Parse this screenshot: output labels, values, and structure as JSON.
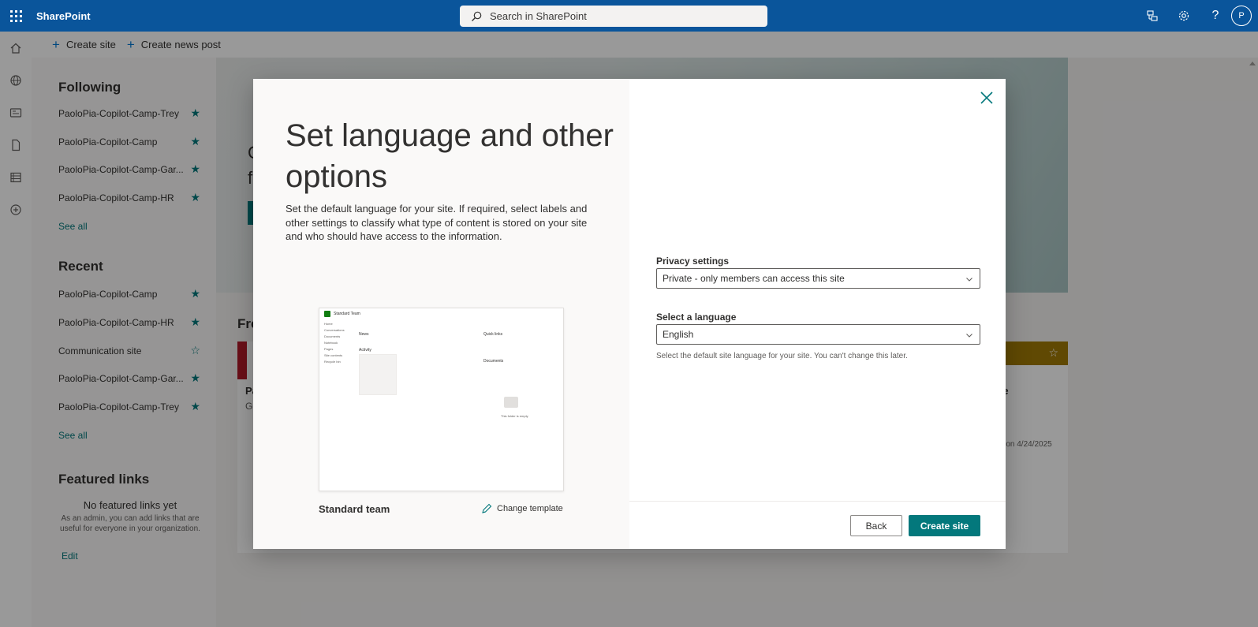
{
  "topbar": {
    "brand": "SharePoint",
    "search_placeholder": "Search in SharePoint",
    "avatar_initial": "P"
  },
  "commandbar": {
    "create_site": "Create site",
    "create_news": "Create news post"
  },
  "leftnav": {
    "following_heading": "Following",
    "following": [
      "PaoloPia-Copilot-Camp-Trey",
      "PaoloPia-Copilot-Camp",
      "PaoloPia-Copilot-Camp-Gar...",
      "PaoloPia-Copilot-Camp-HR"
    ],
    "see_all": "See all",
    "recent_heading": "Recent",
    "recent": [
      "PaoloPia-Copilot-Camp",
      "PaoloPia-Copilot-Camp-HR",
      "Communication site",
      "PaoloPia-Copilot-Camp-Gar...",
      "PaoloPia-Copilot-Camp-Trey"
    ],
    "featured_heading": "Featured links",
    "featured_empty_title": "No featured links yet",
    "featured_empty_desc": "As an admin, you can add links that are useful for everyone in your organization.",
    "edit": "Edit"
  },
  "background": {
    "section_partial": "Fre",
    "card_text_partial": "te",
    "date_partial": "e on 4/24/2025",
    "card_letters": [
      "Pa",
      "Gr"
    ],
    "hero_letters": [
      "C",
      "f"
    ]
  },
  "dialog": {
    "title": "Set language and other options",
    "description": "Set the default language for your site. If required, select labels and other settings to classify what type of content is stored on your site and who should have access to the information.",
    "template_name": "Standard team",
    "change_template": "Change template",
    "privacy_label": "Privacy settings",
    "privacy_value": "Private - only members can access this site",
    "language_label": "Select a language",
    "language_value": "English",
    "language_help": "Select the default site language for your site. You can't change this later.",
    "back": "Back",
    "create": "Create site",
    "preview": {
      "site_title": "Standard Team",
      "nav": [
        "Home",
        "Conversations",
        "Documents",
        "Notebook",
        "Pages",
        "Site contents",
        "Recycle bin"
      ],
      "news": "News",
      "activity": "Activity",
      "quick_links": "Quick links",
      "documents": "Documents",
      "empty": "This folder is empty"
    }
  },
  "colors": {
    "topbar": "#0a559b",
    "accent": "#03787c"
  }
}
